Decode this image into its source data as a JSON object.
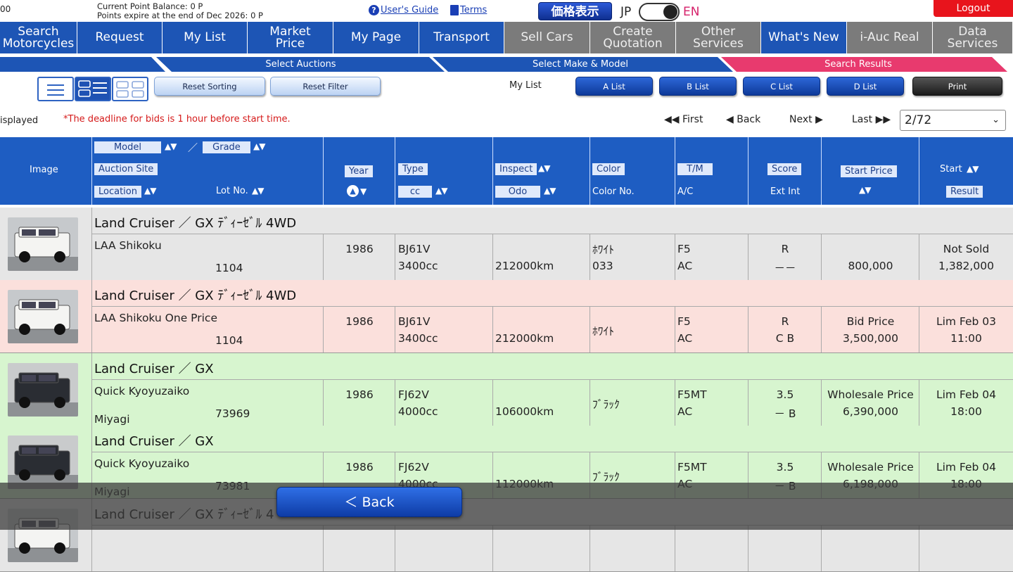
{
  "topbar": {
    "left_cut": "00",
    "point_balance": "Current Point Balance: 0 P",
    "points_expire": "Points expire at the end of Dec 2026: 0 P",
    "users_guide": "User's Guide",
    "terms": "Terms",
    "price_display": "価格表示",
    "lang_jp": "JP",
    "lang_en": "EN",
    "logout": "Logout"
  },
  "nav": [
    {
      "label": "Search\nMotorcycles",
      "state": "blue"
    },
    {
      "label": "Request",
      "state": "blue"
    },
    {
      "label": "My List",
      "state": "blue"
    },
    {
      "label": "Market\nPrice",
      "state": "blue"
    },
    {
      "label": "My Page",
      "state": "blue"
    },
    {
      "label": "Transport",
      "state": "blue"
    },
    {
      "label": "Sell Cars",
      "state": "gray"
    },
    {
      "label": "Create\nQuotation",
      "state": "gray"
    },
    {
      "label": "Other\nServices",
      "state": "gray"
    },
    {
      "label": "What's New",
      "state": "blue"
    },
    {
      "label": "i-Auc Real",
      "state": "gray"
    },
    {
      "label": "Data\nServices",
      "state": "gray"
    }
  ],
  "steps": {
    "select_auctions": "Select Auctions",
    "select_make_model": "Select Make & Model",
    "search_results": "Search Results"
  },
  "toolbar": {
    "reset_sorting": "Reset Sorting",
    "reset_filter": "Reset Filter",
    "my_list_label": "My List",
    "a_list": "A List",
    "b_list": "B List",
    "c_list": "C List",
    "d_list": "D List",
    "print": "Print"
  },
  "info": {
    "displayed": "isplayed",
    "deadline_note": "*The deadline for bids is 1 hour before start time."
  },
  "pager": {
    "first": "First",
    "back": "Back",
    "next": "Next",
    "last": "Last",
    "current": "2/72"
  },
  "headers": {
    "image": "Image",
    "model": "Model",
    "grade": "Grade",
    "slash": "／",
    "auction_site": "Auction Site",
    "location": "Location",
    "lot_no": "Lot No.",
    "year": "Year",
    "type": "Type",
    "cc": "cc",
    "inspect": "Inspect",
    "odo": "Odo",
    "color": "Color",
    "color_no": "Color No.",
    "tm": "T/M",
    "ac": "A/C",
    "score": "Score",
    "ext_int": "Ext Int",
    "start_price": "Start Price",
    "start": "Start",
    "result": "Result"
  },
  "rows": [
    {
      "bg": "#e6e6e6",
      "title": "Land Cruiser ／ GX ﾃﾞｨｰｾﾞﾙ 4WD",
      "site": "LAA Shikoku",
      "location": "",
      "lot": "1104",
      "year": "1986",
      "type": "BJ61V",
      "cc": "3400cc",
      "odo": "212000km",
      "color": "ﾎﾜｲﾄ",
      "color_no": "033",
      "tm": "F5",
      "ac": "AC",
      "score": "R",
      "ext_int": "－－",
      "price_label": "",
      "price": "800,000",
      "start": "Not Sold",
      "result": "1,382,000",
      "car": "white"
    },
    {
      "bg": "#fbe0dc",
      "title": "Land Cruiser ／ GX ﾃﾞｨｰｾﾞﾙ 4WD",
      "site": "LAA Shikoku One Price",
      "location": "",
      "lot": "1104",
      "year": "1986",
      "type": "BJ61V",
      "cc": "3400cc",
      "odo": "212000km",
      "color": "ﾎﾜｲﾄ",
      "color_no": "",
      "tm": "F5",
      "ac": "AC",
      "score": "R",
      "ext_int": "C B",
      "price_label": "Bid Price",
      "price": "3,500,000",
      "start": "Lim  Feb 03",
      "result": "11:00",
      "car": "white"
    },
    {
      "bg": "#d7f5cf",
      "title": "Land Cruiser ／ GX",
      "site": "Quick Kyoyuzaiko",
      "location": "Miyagi",
      "lot": "73969",
      "year": "1986",
      "type": "FJ62V",
      "cc": "4000cc",
      "odo": "106000km",
      "color": "ﾌﾞﾗｯｸ",
      "color_no": "",
      "tm": "F5MT",
      "ac": "AC",
      "score": "3.5",
      "ext_int": "－ B",
      "price_label": "Wholesale Price",
      "price": "6,390,000",
      "start": "Lim  Feb 04",
      "result": "18:00",
      "car": "black"
    },
    {
      "bg": "#d7f5cf",
      "title": "Land Cruiser ／ GX",
      "site": "Quick Kyoyuzaiko",
      "location": "Miyagi",
      "lot": "73981",
      "year": "1986",
      "type": "FJ62V",
      "cc": "4000cc",
      "odo": "112000km",
      "color": "ﾌﾞﾗｯｸ",
      "color_no": "",
      "tm": "F5MT",
      "ac": "AC",
      "score": "3.5",
      "ext_int": "－ B",
      "price_label": "Wholesale Price",
      "price": "6,198,000",
      "start": "Lim  Feb 04",
      "result": "18:00",
      "car": "black"
    },
    {
      "bg": "#e6e6e6",
      "title": "Land Cruiser ／ GX ﾃﾞｨｰｾﾞﾙ 4",
      "site": "",
      "location": "",
      "lot": "",
      "year": "",
      "type": "",
      "cc": "",
      "odo": "",
      "color": "",
      "color_no": "",
      "tm": "",
      "ac": "",
      "score": "",
      "ext_int": "",
      "price_label": "",
      "price": "",
      "start": "",
      "result": "",
      "car": "white"
    }
  ],
  "back_button": "＜ Back"
}
